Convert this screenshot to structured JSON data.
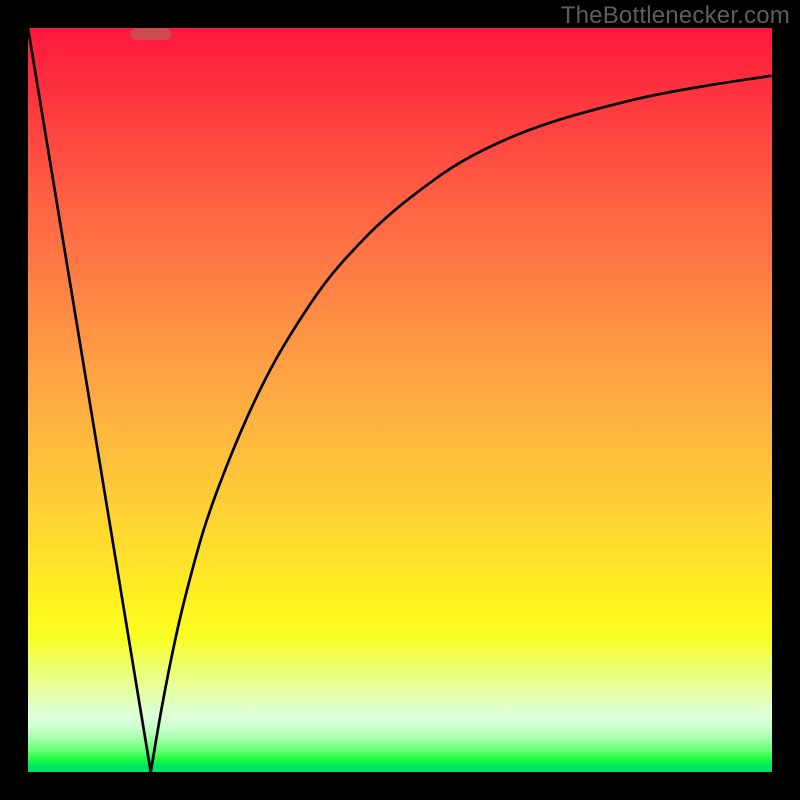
{
  "watermark": "TheBottlenecker.com",
  "colors": {
    "curve": "#000000",
    "marker": "#cc4b4c",
    "frame": "#000000"
  },
  "chart_data": {
    "type": "line",
    "title": "",
    "xlabel": "",
    "ylabel": "",
    "x_range_pct": [
      0,
      100
    ],
    "y_range_pct": [
      0,
      100
    ],
    "optimal_x_pct": 16.5,
    "marker": {
      "x_pct": 16.5,
      "width_pct": 5.5,
      "y_pct": 99.2,
      "height_pct": 1.6
    },
    "series": [
      {
        "name": "left-descent",
        "x_pct": [
          0,
          16.5
        ],
        "y_pct": [
          100,
          0
        ]
      },
      {
        "name": "right-ascent",
        "x_pct": [
          16.5,
          18,
          20,
          22,
          24,
          27,
          30,
          33,
          36,
          40,
          44,
          48,
          53,
          58,
          64,
          70,
          77,
          84,
          92,
          100
        ],
        "y_pct": [
          0,
          9,
          19,
          27,
          34,
          42,
          49,
          55,
          60,
          66,
          70.5,
          74.5,
          78.5,
          82,
          85,
          87.3,
          89.3,
          91,
          92.4,
          93.6
        ]
      }
    ]
  }
}
